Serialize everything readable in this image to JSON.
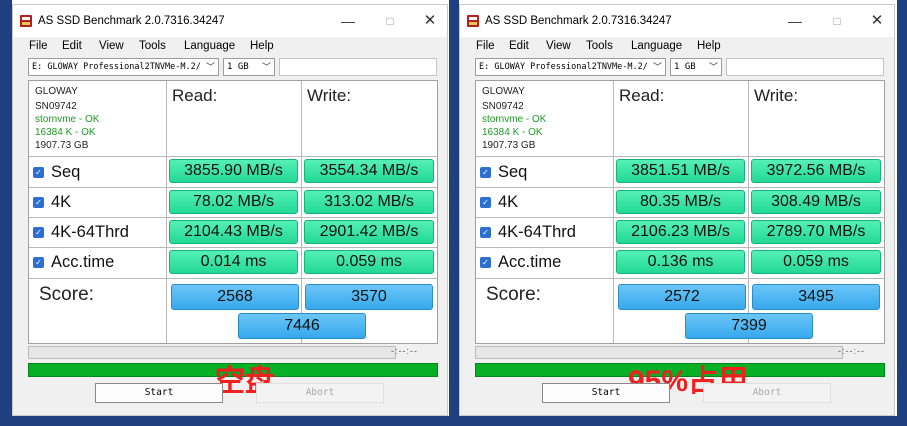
{
  "windows": [
    {
      "title": "AS SSD Benchmark 2.0.7316.34247",
      "window_buttons": {
        "minimize": "—",
        "maximize": "□",
        "close": "✕"
      },
      "menu": [
        "File",
        "Edit",
        "View",
        "Tools",
        "Language",
        "Help"
      ],
      "drive": "E: GLOWAY Professional2TNVMe-M.2/",
      "size": "1 GB",
      "path": "",
      "device_info": [
        "GLOWAY",
        "SN09742",
        "stornvme - OK",
        "16384 K - OK",
        "1907.73 GB"
      ],
      "read_header": "Read:",
      "write_header": "Write:",
      "rows": [
        {
          "label": "Seq",
          "read": "3855.90 MB/s",
          "write": "3554.34 MB/s"
        },
        {
          "label": "4K",
          "read": "78.02 MB/s",
          "write": "313.02 MB/s"
        },
        {
          "label": "4K-64Thrd",
          "read": "2104.43 MB/s",
          "write": "2901.42 MB/s"
        },
        {
          "label": "Acc.time",
          "read": "0.014 ms",
          "write": "0.059 ms"
        }
      ],
      "score_label": "Score:",
      "score_read": "2568",
      "score_write": "3570",
      "score_total": "7446",
      "time": "-:--:--",
      "progress": 0,
      "overlay_caption": "空盘",
      "start_label": "Start",
      "abort_label": "Abort"
    },
    {
      "title": "AS SSD Benchmark 2.0.7316.34247",
      "window_buttons": {
        "minimize": "—",
        "maximize": "□",
        "close": "✕"
      },
      "menu": [
        "File",
        "Edit",
        "View",
        "Tools",
        "Language",
        "Help"
      ],
      "drive": "E: GLOWAY Professional2TNVMe-M.2/",
      "size": "1 GB",
      "path": "",
      "device_info": [
        "GLOWAY",
        "SN09742",
        "stornvme - OK",
        "16384 K - OK",
        "1907.73 GB"
      ],
      "read_header": "Read:",
      "write_header": "Write:",
      "rows": [
        {
          "label": "Seq",
          "read": "3851.51 MB/s",
          "write": "3972.56 MB/s"
        },
        {
          "label": "4K",
          "read": "80.35 MB/s",
          "write": "308.49 MB/s"
        },
        {
          "label": "4K-64Thrd",
          "read": "2106.23 MB/s",
          "write": "2789.70 MB/s"
        },
        {
          "label": "Acc.time",
          "read": "0.136 ms",
          "write": "0.059 ms"
        }
      ],
      "score_label": "Score:",
      "score_read": "2572",
      "score_write": "3495",
      "score_total": "7399",
      "time": "-:--:--",
      "progress": 0,
      "overlay_caption": "95%占用",
      "start_label": "Start",
      "abort_label": "Abort"
    }
  ],
  "colors": {
    "taskbar": "#1f3f7f",
    "result_green": "#22d895",
    "score_blue": "#36a8ec",
    "status_ok": "#1d9a24",
    "status_bar": "#06b025",
    "overlay_red": "#ee2020"
  },
  "icons": {
    "app": "as-ssd-app-icon",
    "checkbox": "checked-checkbox-icon",
    "dropdown": "chevron-down-icon"
  }
}
